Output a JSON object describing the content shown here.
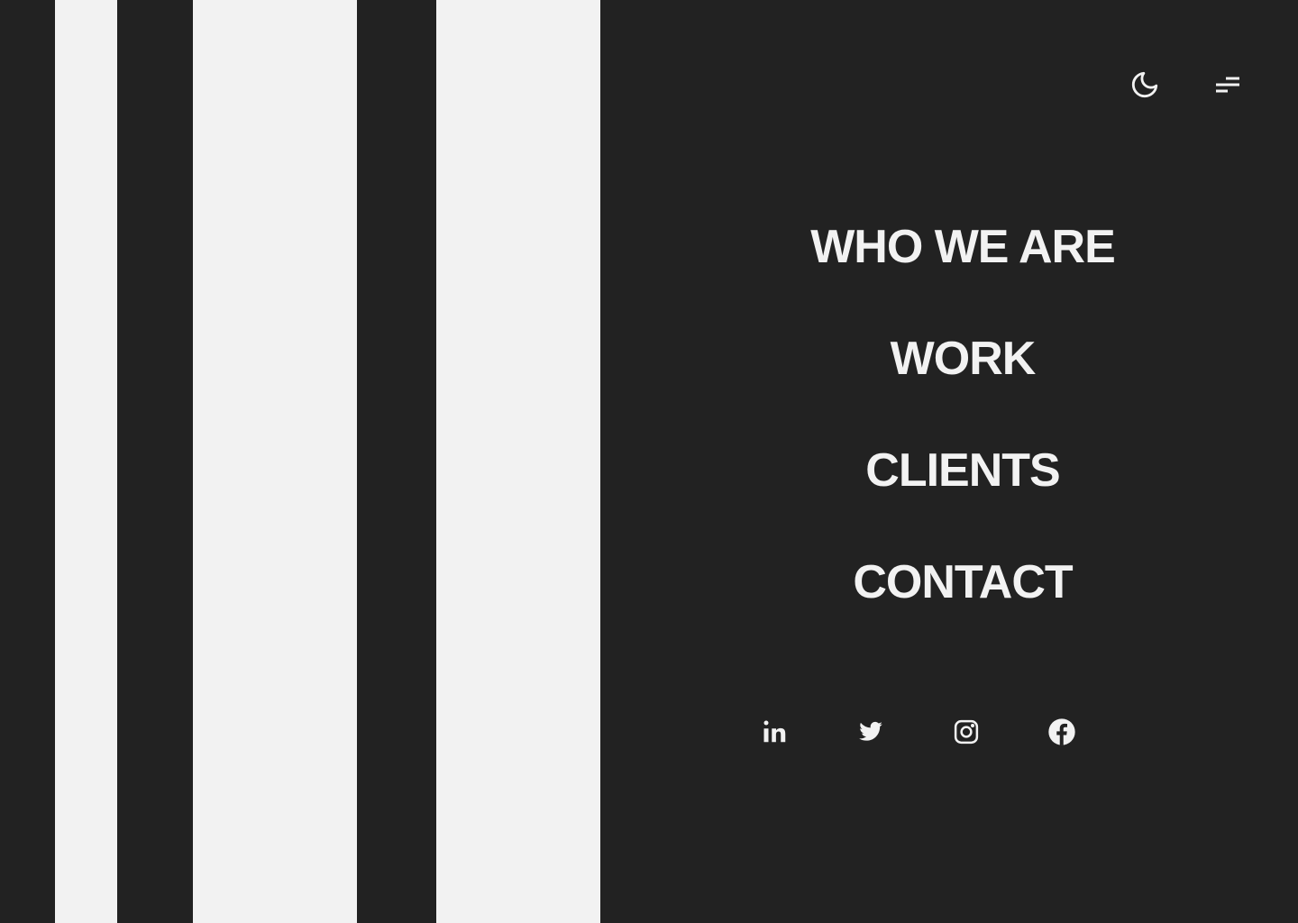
{
  "menu": {
    "items": [
      {
        "label": "WHO WE ARE"
      },
      {
        "label": "WORK"
      },
      {
        "label": "CLIENTS"
      },
      {
        "label": "CONTACT"
      }
    ]
  },
  "header": {
    "icons": [
      "moon-icon",
      "menu-icon"
    ]
  },
  "socials": {
    "icons": [
      "linkedin-icon",
      "twitter-icon",
      "instagram-icon",
      "facebook-icon"
    ]
  },
  "colors": {
    "background": "#222222",
    "foreground": "#f2f2f2"
  }
}
